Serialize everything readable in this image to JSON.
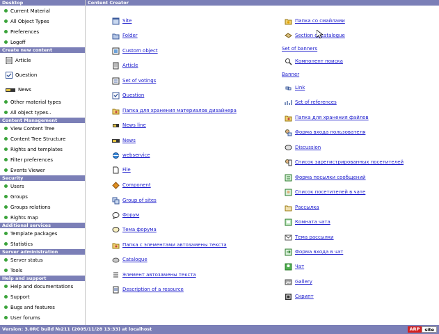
{
  "sidebar": {
    "sections": [
      {
        "title": "Desktop",
        "items": [
          {
            "label": "Current Material",
            "icon": "dot"
          },
          {
            "label": "All Object Types",
            "icon": "dot"
          },
          {
            "label": "Preferences",
            "icon": "dot"
          },
          {
            "label": "Logoff",
            "icon": "dot"
          }
        ]
      },
      {
        "title": "Create new content",
        "items": [
          {
            "label": "Article",
            "icon": "article",
            "big": true
          },
          {
            "label": "Question",
            "icon": "question",
            "big": true
          },
          {
            "label": "News",
            "icon": "news",
            "big": true
          },
          {
            "label": "Other material types",
            "icon": "dot"
          },
          {
            "label": "All object types..",
            "icon": "dot"
          }
        ]
      },
      {
        "title": "Content Management",
        "items": [
          {
            "label": "View Content Tree",
            "icon": "dot"
          },
          {
            "label": "Content Tree Structure",
            "icon": "dot"
          },
          {
            "label": "Rights and templates",
            "icon": "dot"
          },
          {
            "label": "Filter preferences",
            "icon": "dot"
          },
          {
            "label": "Events Viewer",
            "icon": "dot"
          }
        ]
      },
      {
        "title": "Security",
        "items": [
          {
            "label": "Users",
            "icon": "dot"
          },
          {
            "label": "Groups",
            "icon": "dot"
          },
          {
            "label": "Groups relations",
            "icon": "dot"
          },
          {
            "label": "Rights map",
            "icon": "dot"
          }
        ]
      },
      {
        "title": "Additional services",
        "items": [
          {
            "label": "Template packages",
            "icon": "dot"
          },
          {
            "label": "Statistics",
            "icon": "dot"
          }
        ]
      },
      {
        "title": "Server administration",
        "items": [
          {
            "label": "Server status",
            "icon": "dot"
          },
          {
            "label": "Tools",
            "icon": "dot"
          }
        ]
      },
      {
        "title": "Help and support",
        "items": [
          {
            "label": "Help and documentations",
            "icon": "dot"
          },
          {
            "label": "Support",
            "icon": "dot"
          },
          {
            "label": "Bugs and features",
            "icon": "dot"
          },
          {
            "label": "User forums",
            "icon": "dot"
          }
        ]
      }
    ]
  },
  "main": {
    "title": "Content Creator",
    "left_column": [
      {
        "label": "Site",
        "icon": "site"
      },
      {
        "label": "Folder",
        "icon": "folder"
      },
      {
        "label": "Custom object",
        "icon": "object"
      },
      {
        "label": "Article",
        "icon": "article"
      },
      {
        "label": "Set of votings",
        "icon": "votings"
      },
      {
        "label": "Question",
        "icon": "question"
      },
      {
        "label": "Папка для хранения материалов дизайнера",
        "icon": "folder-special"
      },
      {
        "label": "News line",
        "icon": "newsline"
      },
      {
        "label": "News",
        "icon": "news"
      },
      {
        "label": "webservice",
        "icon": "webservice"
      },
      {
        "label": "File",
        "icon": "file"
      },
      {
        "label": "Component",
        "icon": "component"
      },
      {
        "label": "Group of sites",
        "icon": "group-sites"
      },
      {
        "label": "Форум",
        "icon": "forum"
      },
      {
        "label": "Тема форума",
        "icon": "forum-topic"
      },
      {
        "label": "Папка с элементами автозамены текста",
        "icon": "folder-special"
      },
      {
        "label": "Catalogue",
        "icon": "catalogue"
      },
      {
        "label": "Элемент автозамены текста",
        "icon": "text-element"
      },
      {
        "label": "Description of a resource",
        "icon": "description"
      }
    ],
    "right_column": [
      {
        "label": "Папка со смайлами",
        "icon": "smiley-folder",
        "link": true
      },
      {
        "label": "Section of catalogue",
        "icon": "catalogue-section",
        "link": true
      },
      {
        "label": "Set of banners",
        "icon": "none",
        "link": true
      },
      {
        "label": "Компонент поиска",
        "icon": "search",
        "link": true
      },
      {
        "label": "Banner",
        "icon": "none",
        "link": true
      },
      {
        "label": "Link",
        "icon": "link",
        "link": true
      },
      {
        "label": "Set of references",
        "icon": "references",
        "link": true
      },
      {
        "label": "Папка для хранения файлов",
        "icon": "folder-special",
        "link": true
      },
      {
        "label": "Форма входа пользователя",
        "icon": "login-form",
        "link": true
      },
      {
        "label": "Discussion",
        "icon": "discussion",
        "link": true
      },
      {
        "label": "Список зарегистрированных посетителей",
        "icon": "users-list",
        "link": true
      },
      {
        "label": "Форма посылки сообщений",
        "icon": "message-form",
        "link": true
      },
      {
        "label": "Список посетителей в чате",
        "icon": "chat-users",
        "link": true
      },
      {
        "label": "Рассылка",
        "icon": "mailing",
        "link": true
      },
      {
        "label": "Комната чата",
        "icon": "chat-room",
        "link": true
      },
      {
        "label": "Тема рассылки",
        "icon": "mail-topic",
        "link": true
      },
      {
        "label": "Форма входа в чат",
        "icon": "chat-login",
        "link": true
      },
      {
        "label": "Чат",
        "icon": "chat",
        "link": true
      },
      {
        "label": "Gallery",
        "icon": "gallery",
        "link": true
      },
      {
        "label": "Скрипт",
        "icon": "script",
        "link": true
      }
    ]
  },
  "status": {
    "text": "Version: 3.0RC build №211 (2005/11/28 13:33) at localhost",
    "logo_a": "ARP",
    "logo_b": "site"
  },
  "colors": {
    "header": "#7b7fb7",
    "link": "#1a1acc",
    "dot": "#3aa33a"
  }
}
